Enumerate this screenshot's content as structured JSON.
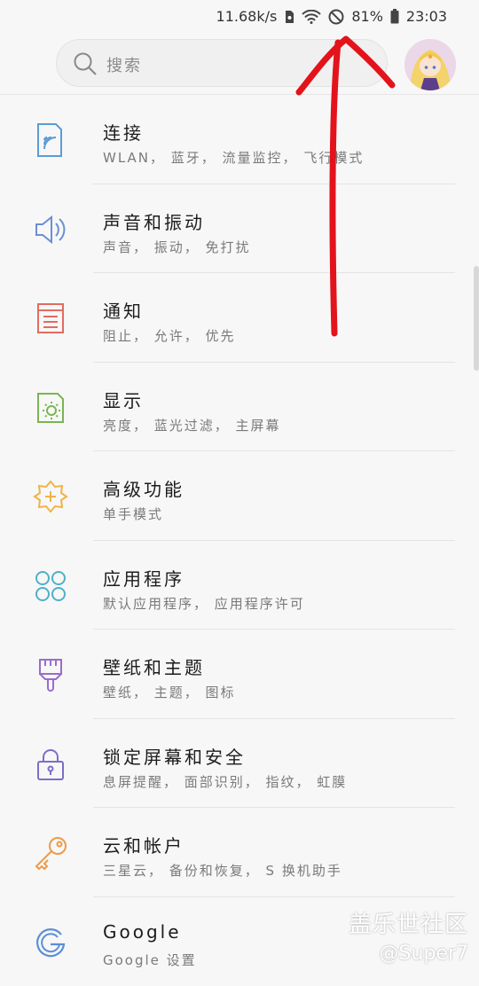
{
  "status_bar": {
    "net_speed": "11.68k/s",
    "battery_percent": "81%",
    "time": "23:03",
    "icons": [
      "sim-icon",
      "wifi-icon",
      "do-not-disturb-icon",
      "battery-icon"
    ]
  },
  "search": {
    "placeholder": "搜索"
  },
  "settings": [
    {
      "title": "连接",
      "subtitle": "WLAN， 蓝牙， 流量监控， 飞行模式",
      "icon": "connection-icon",
      "color": "#5b9bd5"
    },
    {
      "title": "声音和振动",
      "subtitle": "声音， 振动， 免打扰",
      "icon": "speaker-icon",
      "color": "#6b8fd8"
    },
    {
      "title": "通知",
      "subtitle": "阻止， 允许， 优先",
      "icon": "notification-icon",
      "color": "#e36b61"
    },
    {
      "title": "显示",
      "subtitle": "亮度， 蓝光过滤， 主屏幕",
      "icon": "display-icon",
      "color": "#7ab552"
    },
    {
      "title": "高级功能",
      "subtitle": "单手模式",
      "icon": "advanced-features-icon",
      "color": "#f0b346"
    },
    {
      "title": "应用程序",
      "subtitle": "默认应用程序， 应用程序许可",
      "icon": "apps-icon",
      "color": "#4fb0c9"
    },
    {
      "title": "壁纸和主题",
      "subtitle": "壁纸， 主题， 图标",
      "icon": "brush-icon",
      "color": "#9a6ccc"
    },
    {
      "title": "锁定屏幕和安全",
      "subtitle": "息屏提醒， 面部识别， 指纹， 虹膜",
      "icon": "lock-icon",
      "color": "#7a6fc8"
    },
    {
      "title": "云和帐户",
      "subtitle": "三星云， 备份和恢复， S 换机助手",
      "icon": "key-icon",
      "color": "#ee9a48"
    },
    {
      "title": "Google",
      "subtitle": "Google 设置",
      "icon": "google-icon",
      "color": "#5b8fd8"
    }
  ],
  "colors": {
    "annotation_arrow": "#e3131b",
    "background": "#f7f7f7"
  },
  "watermark": {
    "line1": "盖乐世社区",
    "line2": "@Super7"
  }
}
